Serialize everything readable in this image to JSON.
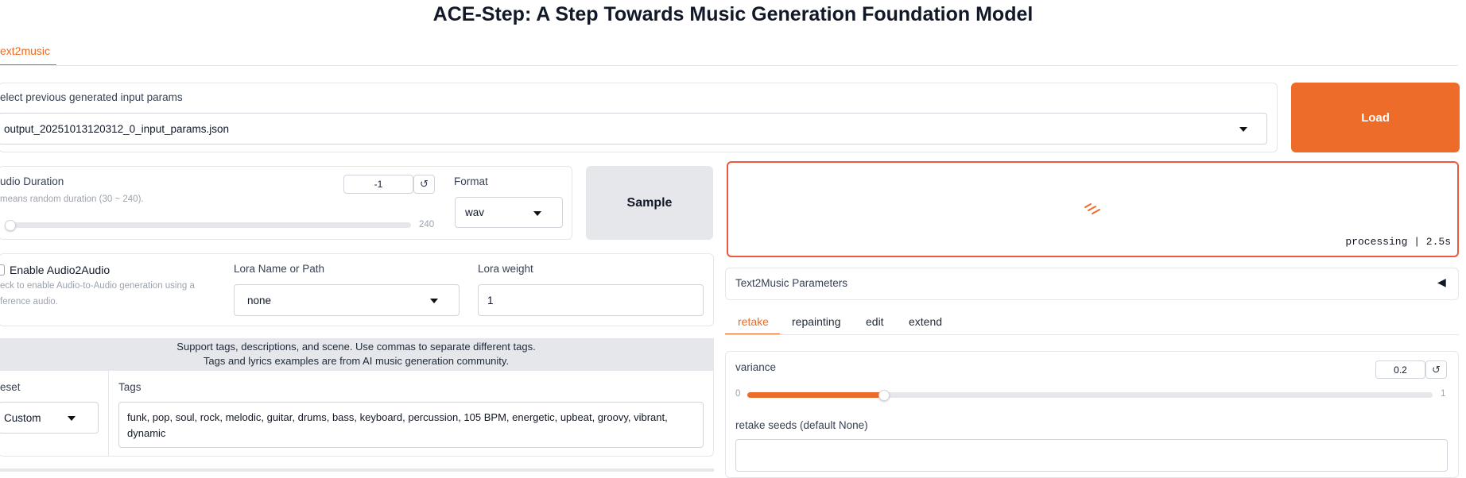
{
  "header": {
    "title": "ACE-Step: A Step Towards Music Generation Foundation Model"
  },
  "tabs": [
    {
      "label": "ext2music",
      "active": true
    }
  ],
  "params_select": {
    "label": "elect previous generated input params",
    "value": "output_20251013120312_0_input_params.json",
    "load_label": "Load"
  },
  "duration": {
    "label": "udio Duration",
    "hint": "means random duration (30 ~ 240).",
    "value": "-1",
    "slider_max_label": "240",
    "reset_icon": "↺"
  },
  "format": {
    "label": "Format",
    "value": "wav"
  },
  "sample_button": {
    "label": "Sample"
  },
  "audio2audio": {
    "label": "Enable Audio2Audio",
    "hint_line1": "eck to enable Audio-to-Audio generation using a",
    "hint_line2": "ference audio.",
    "checked": false
  },
  "lora": {
    "name_label": "Lora Name or Path",
    "name_value": "none",
    "weight_label": "Lora weight",
    "weight_value": "1"
  },
  "tags_info": {
    "line1": "Support tags, descriptions, and scene. Use commas to separate different tags.",
    "line2": "Tags and lyrics examples are from AI music generation community."
  },
  "preset": {
    "label": "eset",
    "value": "Custom"
  },
  "tags": {
    "label": "Tags",
    "value_line1": "funk, pop, soul, rock, melodic, guitar, drums, bass, keyboard, percussion, 105 BPM, energetic, upbeat, groovy, vibrant,",
    "value_line2": "dynamic"
  },
  "output": {
    "status": "processing | 2.5s",
    "accent": "#ea5a3a"
  },
  "accordion": {
    "label": "Text2Music Parameters",
    "toggle_icon": "◀"
  },
  "subtabs": [
    {
      "label": "retake",
      "active": true
    },
    {
      "label": "repainting",
      "active": false
    },
    {
      "label": "edit",
      "active": false
    },
    {
      "label": "extend",
      "active": false
    }
  ],
  "variance": {
    "label": "variance",
    "value": "0.2",
    "min_label": "0",
    "max_label": "1",
    "fill_fraction": 0.2,
    "reset_icon": "↺"
  },
  "retake_seeds": {
    "label": "retake seeds (default None)",
    "value": ""
  },
  "colors": {
    "accent": "#ee6c2a",
    "tab_accent": "#ea6a22"
  }
}
